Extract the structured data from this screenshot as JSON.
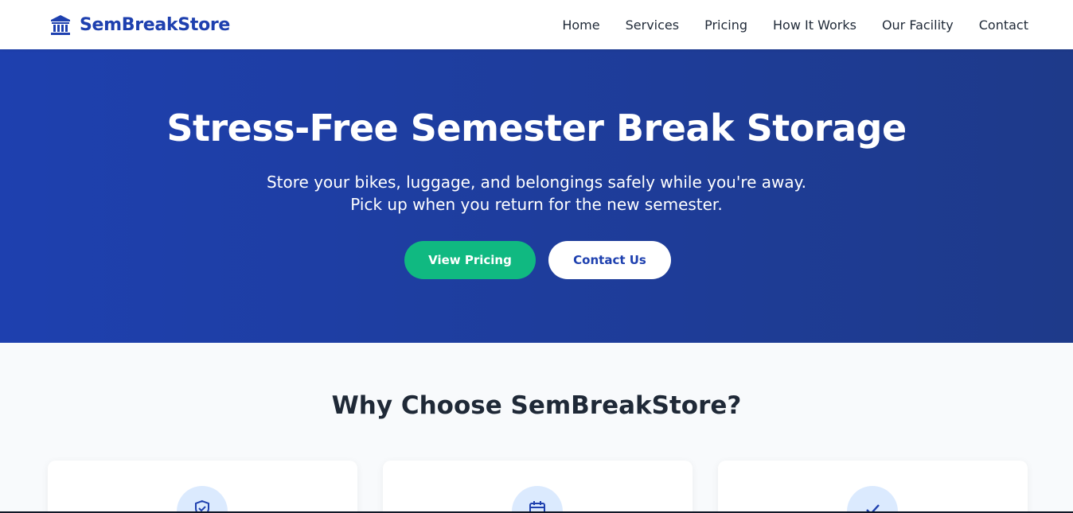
{
  "brand": {
    "name": "SemBreakStore",
    "icon": "building-columns-icon",
    "color": "#1e40af"
  },
  "nav": {
    "items": [
      {
        "label": "Home"
      },
      {
        "label": "Services"
      },
      {
        "label": "Pricing"
      },
      {
        "label": "How It Works"
      },
      {
        "label": "Our Facility"
      },
      {
        "label": "Contact"
      }
    ]
  },
  "hero": {
    "title": "Stress-Free Semester Break Storage",
    "subtitle_line1": "Store your bikes, luggage, and belongings safely while you're away.",
    "subtitle_line2": "Pick up when you return for the new semester.",
    "primary_button": "View Pricing",
    "secondary_button": "Contact Us",
    "gradient_start": "#1e40af",
    "gradient_end": "#1e3a8a",
    "primary_color": "#10b981"
  },
  "features": {
    "title": "Why Choose SemBreakStore?",
    "cards": [
      {
        "icon": "shield-check-icon"
      },
      {
        "icon": "calendar-icon"
      },
      {
        "icon": "check-icon"
      }
    ]
  }
}
